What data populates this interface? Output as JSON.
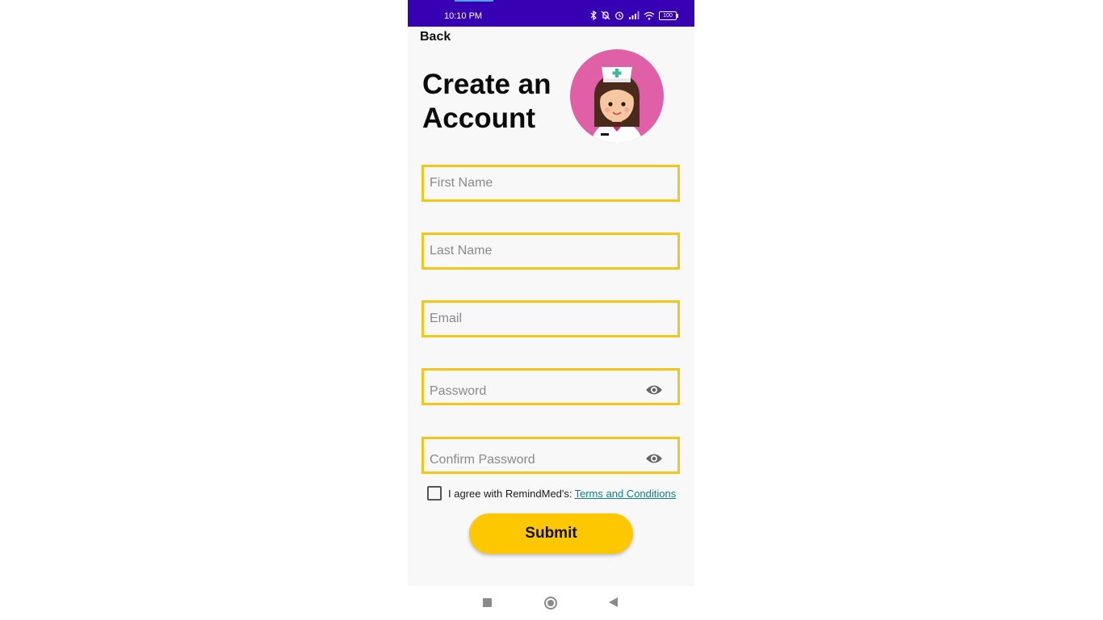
{
  "status_bar": {
    "time": "10:10 PM",
    "battery": "100",
    "bg_color": "#3700b3"
  },
  "header": {
    "back_label": "Back",
    "title_line1": "Create an",
    "title_line2": "Account",
    "avatar_icon": "nurse-avatar-icon"
  },
  "form": {
    "first_name": {
      "placeholder": "First Name",
      "value": ""
    },
    "last_name": {
      "placeholder": "Last Name",
      "value": ""
    },
    "email": {
      "placeholder": "Email",
      "value": ""
    },
    "password": {
      "placeholder": "Password",
      "value": "",
      "toggle_icon": "eye-icon"
    },
    "confirm_password": {
      "placeholder": "Confirm Password",
      "value": "",
      "toggle_icon": "eye-icon"
    },
    "field_border_color": "#f5c518",
    "agree_text": "I agree with RemindMed's:",
    "terms_link": "Terms and Conditions",
    "terms_checked": false,
    "submit_label": "Submit",
    "submit_color": "#fdc800"
  },
  "nav_bar": {
    "items": [
      "recents-square-icon",
      "home-circle-icon",
      "back-triangle-icon"
    ]
  }
}
